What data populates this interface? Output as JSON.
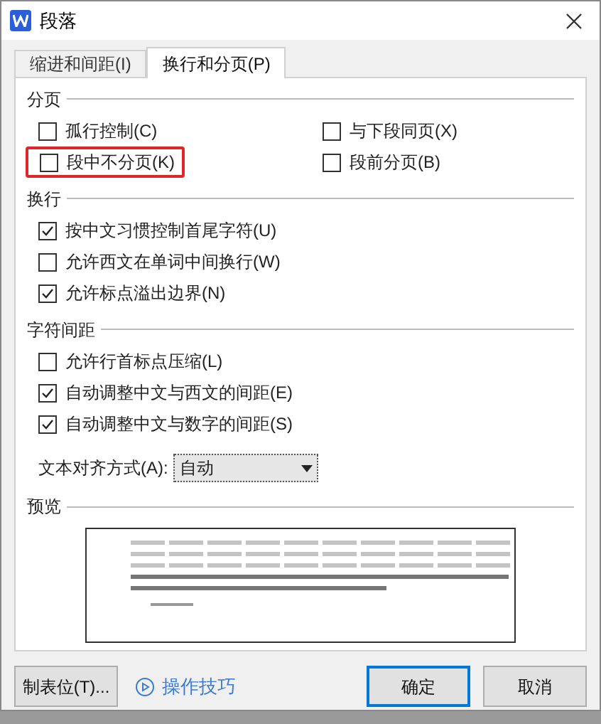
{
  "window": {
    "title": "段落"
  },
  "tabs": [
    {
      "label": "缩进和间距(I)",
      "selected": false
    },
    {
      "label": "换行和分页(P)",
      "selected": true
    }
  ],
  "sections": [
    {
      "title": "分页",
      "kind": "grid",
      "options": [
        {
          "label": "孤行控制(C)",
          "checked": false,
          "highlighted": false
        },
        {
          "label": "与下段同页(X)",
          "checked": false,
          "highlighted": false
        },
        {
          "label": "段中不分页(K)",
          "checked": false,
          "highlighted": true
        },
        {
          "label": "段前分页(B)",
          "checked": false,
          "highlighted": false
        }
      ]
    },
    {
      "title": "换行",
      "kind": "list",
      "options": [
        {
          "label": "按中文习惯控制首尾字符(U)",
          "checked": true,
          "highlighted": false
        },
        {
          "label": "允许西文在单词中间换行(W)",
          "checked": false,
          "highlighted": false
        },
        {
          "label": "允许标点溢出边界(N)",
          "checked": true,
          "highlighted": false
        }
      ]
    },
    {
      "title": "字符间距",
      "kind": "list",
      "options": [
        {
          "label": "允许行首标点压缩(L)",
          "checked": false,
          "highlighted": false
        },
        {
          "label": "自动调整中文与西文的间距(E)",
          "checked": true,
          "highlighted": false
        },
        {
          "label": "自动调整中文与数字的间距(S)",
          "checked": true,
          "highlighted": false
        }
      ]
    }
  ],
  "alignment": {
    "label": "文本对齐方式(A):",
    "value": "自动"
  },
  "preview": {
    "title": "预览"
  },
  "buttons": [
    {
      "label": "制表位(T)...",
      "kind": "plain"
    },
    {
      "label": "操作技巧",
      "kind": "link"
    },
    {
      "label": "确定",
      "kind": "default"
    },
    {
      "label": "取消",
      "kind": "plain"
    }
  ]
}
